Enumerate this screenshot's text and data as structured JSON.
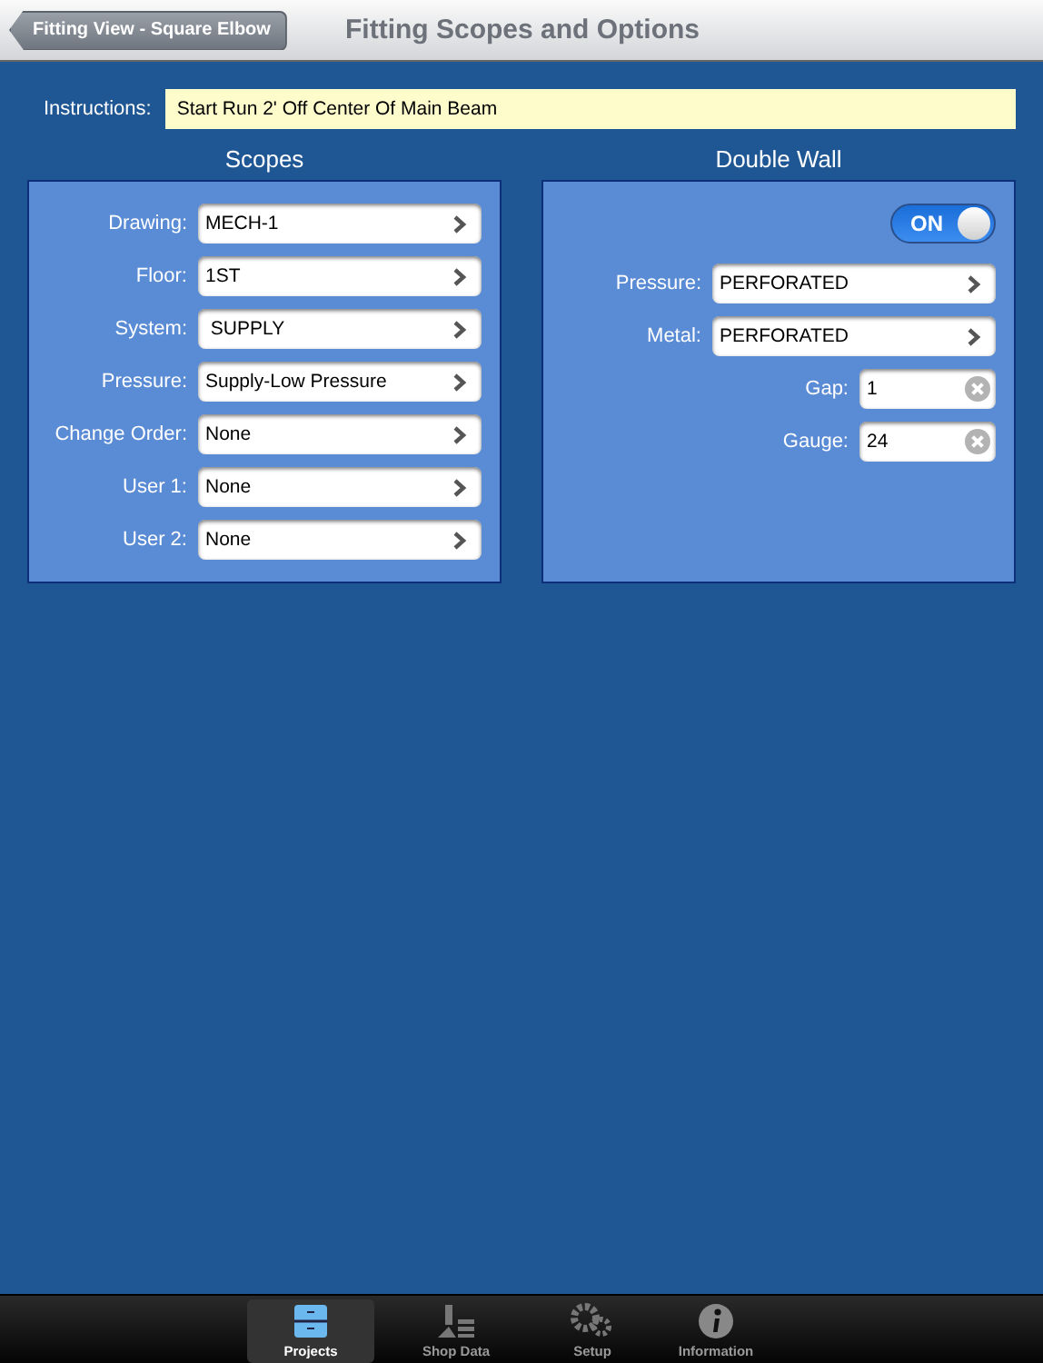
{
  "nav_bar": {
    "back_button": "Fitting View - Square Elbow",
    "title": "Fitting Scopes and Options"
  },
  "instructions": {
    "label": "Instructions:",
    "value": "Start Run 2' Off Center Of Main Beam"
  },
  "scopes": {
    "title": "Scopes",
    "rows": [
      {
        "kind": "picker",
        "label": "Drawing:",
        "value": "MECH-1"
      },
      {
        "kind": "picker",
        "label": "Floor:",
        "value": "1ST"
      },
      {
        "kind": "picker",
        "label": "System:",
        "value": " SUPPLY"
      },
      {
        "kind": "picker",
        "label": "Pressure:",
        "value": "Supply-Low Pressure"
      },
      {
        "kind": "picker",
        "label": "Change Order:",
        "value": "None"
      },
      {
        "kind": "picker",
        "label": "User 1:",
        "value": "None"
      },
      {
        "kind": "picker",
        "label": "User 2:",
        "value": "None"
      }
    ]
  },
  "double_wall": {
    "title": "Double Wall",
    "toggle": {
      "on": true,
      "label": "ON"
    },
    "rows": [
      {
        "kind": "picker",
        "label": "Pressure:",
        "value": "PERFORATED"
      },
      {
        "kind": "picker",
        "label": "Metal:",
        "value": "PERFORATED"
      },
      {
        "kind": "text",
        "label": "Gap:",
        "value": "1"
      },
      {
        "kind": "text",
        "label": "Gauge:",
        "value": "24"
      }
    ]
  },
  "tab_bar": [
    {
      "label": "Projects",
      "selected": true
    },
    {
      "label": "Shop Data",
      "selected": false
    },
    {
      "label": "Setup",
      "selected": false
    },
    {
      "label": "Information",
      "selected": false
    }
  ]
}
